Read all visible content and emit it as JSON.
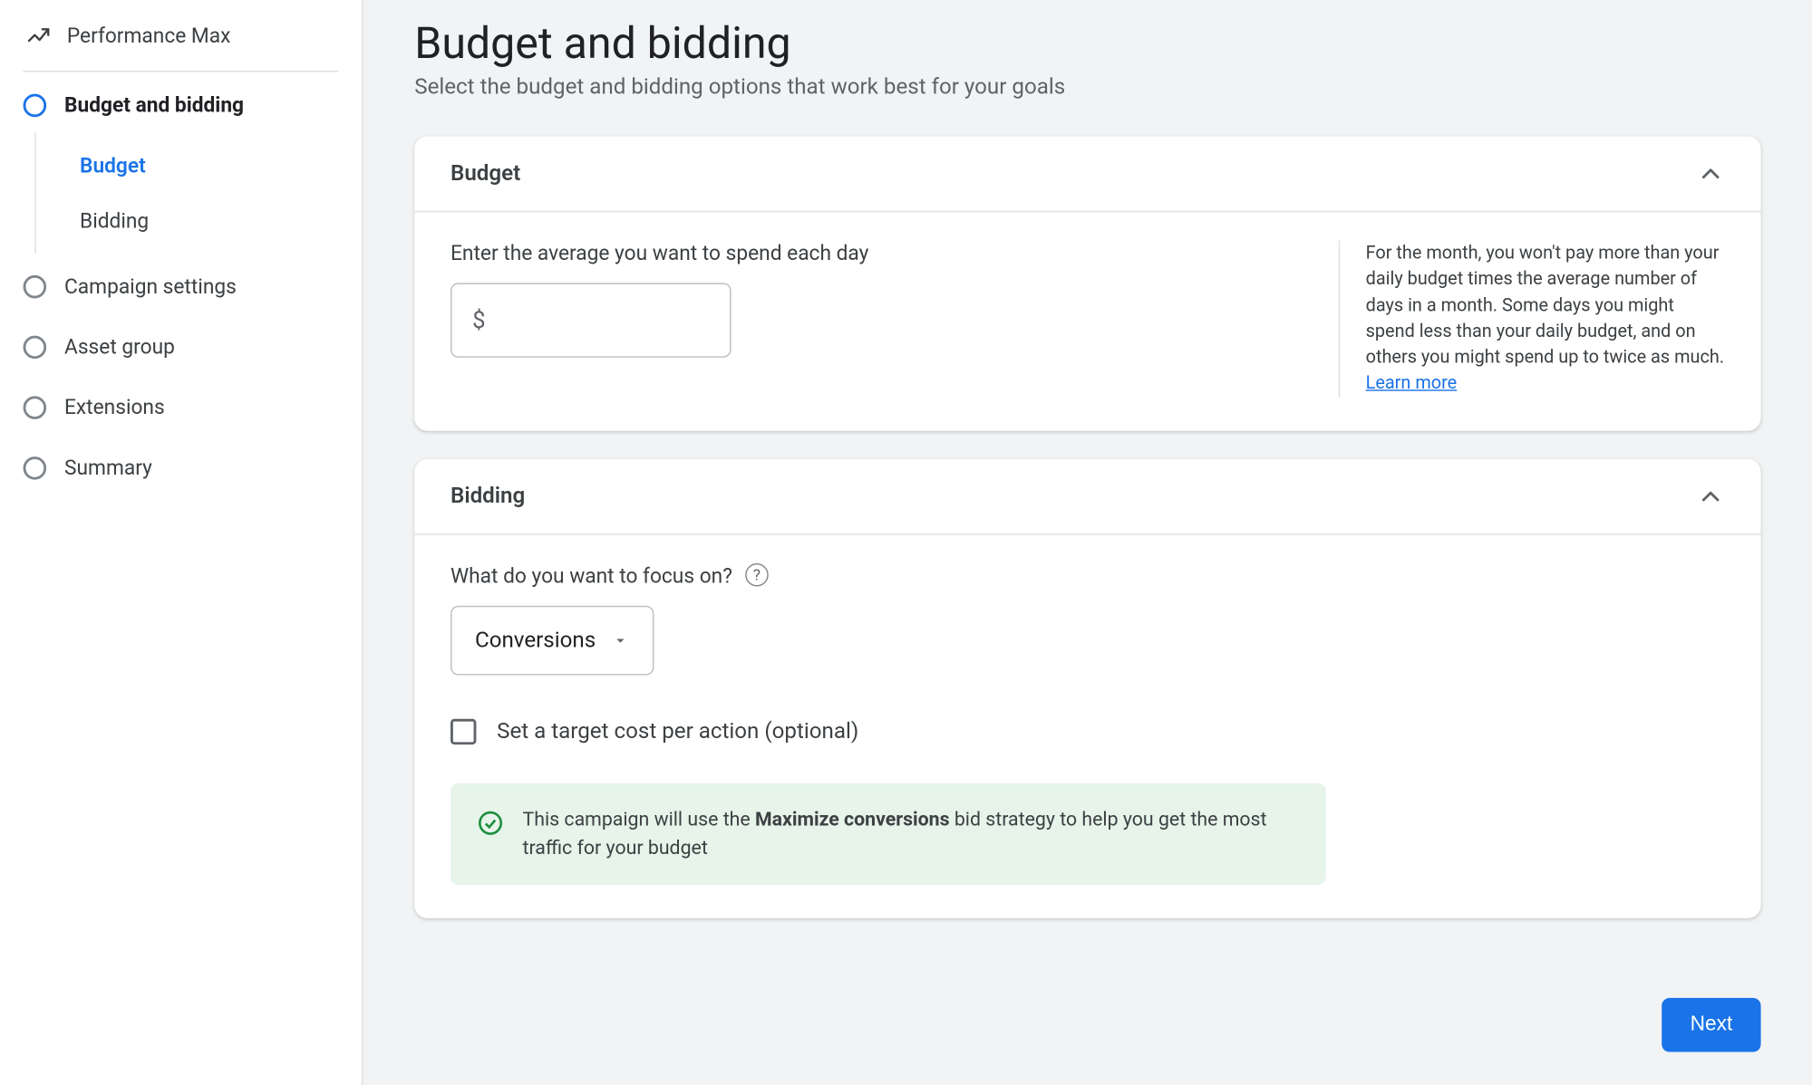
{
  "sidebar": {
    "pmax_label": "Performance Max",
    "steps": [
      {
        "label": "Budget and bidding",
        "sub": [
          {
            "label": "Budget"
          },
          {
            "label": "Bidding"
          }
        ]
      },
      {
        "label": "Campaign settings"
      },
      {
        "label": "Asset group"
      },
      {
        "label": "Extensions"
      },
      {
        "label": "Summary"
      }
    ]
  },
  "page": {
    "title": "Budget and bidding",
    "subtitle": "Select the budget and bidding options that work best for your goals"
  },
  "budget_card": {
    "title": "Budget",
    "field_label": "Enter the average you want to spend each day",
    "currency_symbol": "$",
    "value": "",
    "help_text": "For the month, you won't pay more than your daily budget times the average number of days in a month. Some days you might spend less than your daily budget, and on others you might spend up to twice as much. ",
    "learn_more": "Learn more"
  },
  "bidding_card": {
    "title": "Bidding",
    "focus_label": "What do you want to focus on?",
    "focus_value": "Conversions",
    "target_cpa_label": "Set a target cost per action (optional)",
    "target_cpa_checked": false,
    "notice_prefix": "This campaign will use the ",
    "notice_strategy": "Maximize conversions",
    "notice_suffix": " bid strategy to help you get the most traffic for your budget"
  },
  "footer": {
    "next": "Next"
  }
}
